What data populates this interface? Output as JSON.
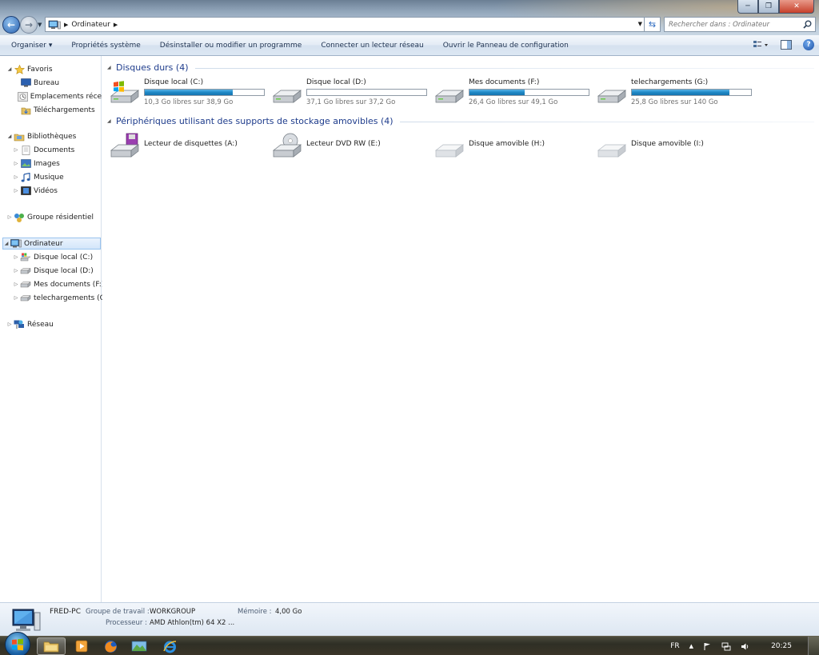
{
  "window": {
    "minimize": "─",
    "maximize": "❐",
    "close": "✕"
  },
  "address": {
    "crumb": "Ordinateur"
  },
  "search": {
    "placeholder": "Rechercher dans : Ordinateur"
  },
  "toolbar": {
    "organize": "Organiser ▾",
    "system_props": "Propriétés système",
    "uninstall": "Désinstaller ou modifier un programme",
    "map_drive": "Connecter un lecteur réseau",
    "control_panel": "Ouvrir le Panneau de configuration",
    "help": "?"
  },
  "nav": {
    "favorites": "Favoris",
    "bureau": "Bureau",
    "recent": "Emplacements récents",
    "downloads": "Téléchargements",
    "libraries": "Bibliothèques",
    "documents": "Documents",
    "images": "Images",
    "music": "Musique",
    "videos": "Vidéos",
    "homegroup": "Groupe résidentiel",
    "computer": "Ordinateur",
    "c": "Disque local (C:)",
    "d": "Disque local (D:)",
    "f": "Mes documents (F:)",
    "g": "telechargements (G:)",
    "network": "Réseau"
  },
  "groups": {
    "hard_disks": "Disques durs (4)",
    "removable": "Périphériques utilisant des supports de stockage amovibles (4)"
  },
  "drives": [
    {
      "name": "Disque local (C:)",
      "free": "10,3 Go libres sur 38,9 Go",
      "used_fraction": 0.735,
      "icon": "windows-drive-icon"
    },
    {
      "name": "Disque local (D:)",
      "free": "37,1 Go libres sur 37,2 Go",
      "used_fraction": 0.003,
      "icon": "hard-drive-icon"
    },
    {
      "name": "Mes documents (F:)",
      "free": "26,4 Go libres sur 49,1 Go",
      "used_fraction": 0.462,
      "icon": "hard-drive-icon"
    },
    {
      "name": "telechargements (G:)",
      "free": "25,8 Go libres sur 140 Go",
      "used_fraction": 0.816,
      "icon": "hard-drive-icon"
    }
  ],
  "removables": [
    {
      "name": "Lecteur de disquettes (A:)",
      "icon": "floppy-drive-icon"
    },
    {
      "name": "Lecteur DVD RW (E:)",
      "icon": "dvd-drive-icon",
      "badge": "DVD"
    },
    {
      "name": "Disque amovible (H:)",
      "icon": "removable-disk-icon"
    },
    {
      "name": "Disque amovible (I:)",
      "icon": "removable-disk-icon"
    }
  ],
  "details": {
    "pc_name": "FRED-PC",
    "workgroup_label": "Groupe de travail :",
    "workgroup": "WORKGROUP",
    "memory_label": "Mémoire :",
    "memory": "4,00 Go",
    "cpu_label": "Processeur :",
    "cpu": "AMD Athlon(tm) 64 X2 ..."
  },
  "taskbar": {
    "lang": "FR",
    "clock": "20:25"
  },
  "colors": {
    "accent": "#1e3c8c",
    "bar_fill": "#1e88c6"
  }
}
